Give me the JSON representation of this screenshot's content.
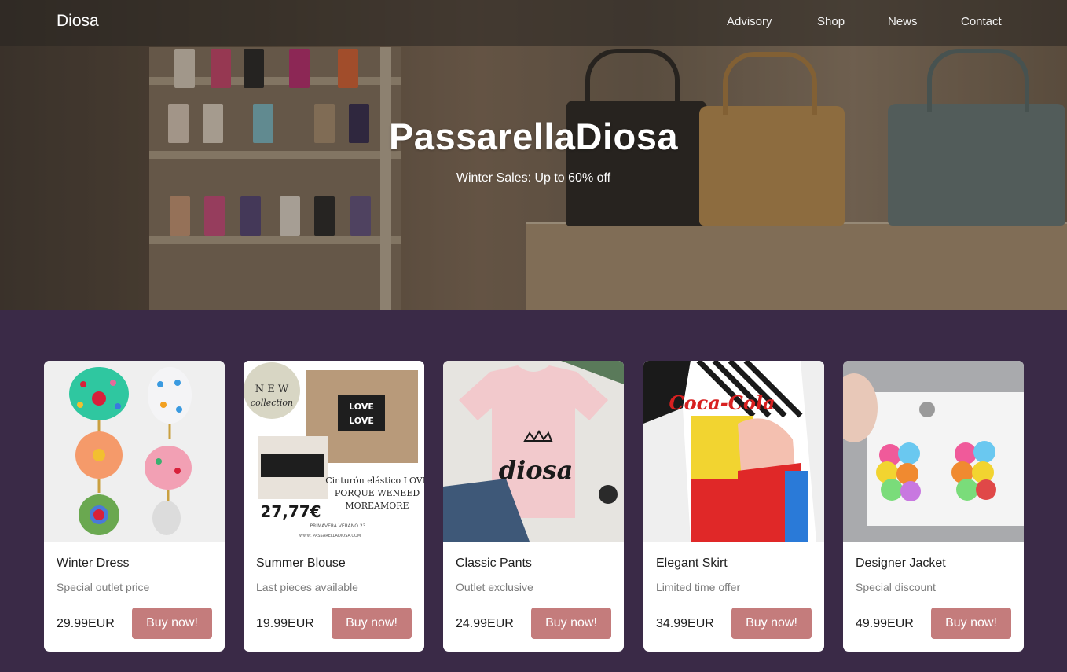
{
  "nav": {
    "brand": "Diosa",
    "links": [
      "Advisory",
      "Shop",
      "News",
      "Contact"
    ]
  },
  "hero": {
    "title": "PassarellaDiosa",
    "subtitle": "Winter Sales: Up to 60% off"
  },
  "products": [
    {
      "title": "Winter Dress",
      "description": "Special outlet price",
      "price": "29.99EUR",
      "button": "Buy now!"
    },
    {
      "title": "Summer Blouse",
      "description": "Last pieces available",
      "price": "19.99EUR",
      "button": "Buy now!"
    },
    {
      "title": "Classic Pants",
      "description": "Outlet exclusive",
      "price": "24.99EUR",
      "button": "Buy now!"
    },
    {
      "title": "Elegant Skirt",
      "description": "Limited time offer",
      "price": "34.99EUR",
      "button": "Buy now!"
    },
    {
      "title": "Designer Jacket",
      "description": "Special discount",
      "price": "49.99EUR",
      "button": "Buy now!"
    }
  ],
  "product_images": {
    "blouse": {
      "badge_line1": "N E W",
      "badge_line2": "collection",
      "price": "27,77€",
      "caption_line1": "Cinturón elástico LOVE",
      "caption_line2": "PORQUE WENEED",
      "caption_line3": "MOREAMORE",
      "season": "PRIMAVERA VERANO 23",
      "site": "WWW. PASSARELLADIOSA.COM",
      "belt_text": "LOVE"
    },
    "tshirt": {
      "print": "diosa"
    },
    "skirt": {
      "print": "Coca-Cola"
    }
  },
  "colors": {
    "background": "#3a2a47",
    "button": "#c47c7c",
    "card": "#ffffff"
  }
}
